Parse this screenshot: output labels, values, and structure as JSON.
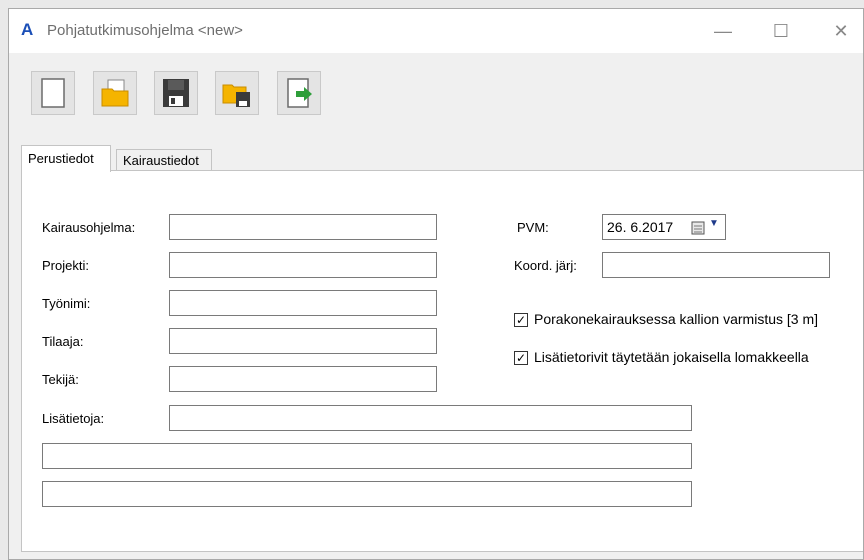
{
  "window": {
    "title": "Pohjatutkimusohjelma <new>",
    "app_icon": "A",
    "minimize": "—",
    "maximize": "☐",
    "close": "✕"
  },
  "toolbar": {
    "buttons": [
      {
        "name": "new-document-icon"
      },
      {
        "name": "open-folder-icon"
      },
      {
        "name": "save-icon"
      },
      {
        "name": "save-to-folder-icon"
      },
      {
        "name": "export-icon"
      }
    ]
  },
  "tabs": [
    {
      "label": "Perustiedot",
      "active": true
    },
    {
      "label": "Kairaustiedot",
      "active": false
    }
  ],
  "form": {
    "kairausohjelma": {
      "label": "Kairausohjelma:",
      "value": ""
    },
    "projekti": {
      "label": "Projekti:",
      "value": ""
    },
    "tyonimi": {
      "label": "Työnimi:",
      "value": ""
    },
    "tilaaja": {
      "label": "Tilaaja:",
      "value": ""
    },
    "tekija": {
      "label": "Tekijä:",
      "value": ""
    },
    "lisatietoja": {
      "label": "Lisätietoja:",
      "value": "",
      "line2": "",
      "line3": ""
    },
    "pvm": {
      "label": "PVM:",
      "value": "26. 6.2017"
    },
    "koord": {
      "label": "Koord. järj:",
      "value": ""
    },
    "checkboxes": [
      {
        "label": "Porakonekairauksessa kallion varmistus [3 m]",
        "checked": true
      },
      {
        "label": "Lisätietorivit täytetään jokaisella lomakkeella",
        "checked": true
      }
    ]
  },
  "colors": {
    "accent": "#1b4fb7",
    "folder": "#f5b400",
    "export_arrow": "#2e9e3a"
  }
}
